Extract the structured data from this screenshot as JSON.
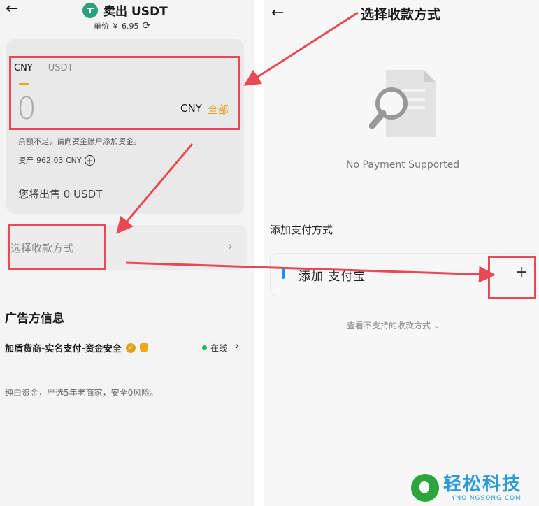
{
  "left": {
    "back_icon": "←",
    "title": "卖出 USDT",
    "price_label": "单价 ￥ 6.95",
    "refresh_icon": "⟳",
    "tabs": [
      {
        "label": "CNY",
        "active": true
      },
      {
        "label": "USDT",
        "active": false
      }
    ],
    "amount_value": "0",
    "currency": "CNY",
    "all_label": "全部",
    "insufficient_text": "余额不足，请向资金账户添加资金。",
    "assets_label": "资产",
    "assets_value": "962.03 CNY",
    "assets_add_icon": "+",
    "sell_summary": "您将出售 0 USDT",
    "payment_select_label": "选择收款方式",
    "payment_select_chevron": "›",
    "advertiser_title": "广告方信息",
    "merchant_name": "加盾货商-实名支付-资金安全",
    "online_status": "在线",
    "merchant_chevron": "›",
    "merchant_desc": "纯白资金，严选5年老商家，安全0风险。"
  },
  "right": {
    "back_icon": "←",
    "title": "选择收款方式",
    "empty_text": "No Payment Supported",
    "add_section_title": "添加支付方式",
    "add_option_label": "添加 支付宝",
    "add_option_plus": "+",
    "unsupported_link": "查看不支持的收款方式 ⌄"
  },
  "watermark": {
    "cn": "轻松科技",
    "en": "YNQINGSONG.COM"
  },
  "colors": {
    "accent": "#e0a418",
    "annotation_red": "#e84a55",
    "online_green": "#21b26b",
    "tether_green": "#26a17b",
    "alipay_blue": "#1a8cff"
  }
}
